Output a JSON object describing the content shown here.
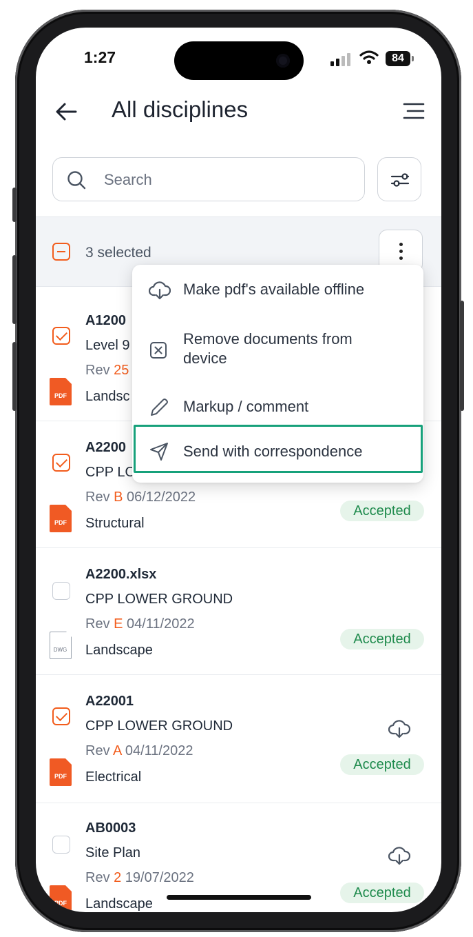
{
  "status_bar": {
    "time": "1:27",
    "battery": "84"
  },
  "header": {
    "title": "All disciplines"
  },
  "search": {
    "placeholder": "Search"
  },
  "selection": {
    "count_label": "3 selected"
  },
  "menu": {
    "items": [
      {
        "label": "Make pdf's available offline",
        "icon": "cloud-download-icon"
      },
      {
        "label_line1": "Remove documents from",
        "label_line2": "device",
        "icon": "remove-box-icon"
      },
      {
        "label": "Markup / comment",
        "icon": "pencil-icon"
      },
      {
        "label": "Send with correspondence",
        "icon": "send-icon",
        "highlighted": true
      }
    ]
  },
  "documents": [
    {
      "name": "A1200",
      "desc": "Level 9",
      "rev_prefix": "Rev ",
      "rev": "25",
      "date": "",
      "discipline": "Landsc",
      "file_type": "PDF",
      "checked": true,
      "status": ""
    },
    {
      "name": "A2200",
      "desc": "CPP LO",
      "rev_prefix": "Rev ",
      "rev": "B",
      "date": " 06/12/2022",
      "discipline": "Structural",
      "file_type": "PDF",
      "checked": true,
      "status": "Accepted"
    },
    {
      "name": "A2200.xlsx",
      "desc": "CPP LOWER GROUND",
      "rev_prefix": "Rev ",
      "rev": "E",
      "date": " 04/11/2022",
      "discipline": "Landscape",
      "file_type": "DWG",
      "checked": false,
      "status": "Accepted"
    },
    {
      "name": "A22001",
      "desc": "CPP LOWER GROUND",
      "rev_prefix": "Rev ",
      "rev": "A",
      "date": " 04/11/2022",
      "discipline": "Electrical",
      "file_type": "PDF",
      "checked": true,
      "status": "Accepted"
    },
    {
      "name": "AB0003",
      "desc": "Site Plan",
      "rev_prefix": "Rev ",
      "rev": "2",
      "date": " 19/07/2022",
      "discipline": "Landscape",
      "file_type": "PDF",
      "checked": false,
      "status": "Accepted"
    }
  ],
  "colors": {
    "accent": "#f25c1c",
    "accepted_bg": "#e6f4ea",
    "accepted_text": "#1e8a4c",
    "highlight": "#17a17b"
  }
}
